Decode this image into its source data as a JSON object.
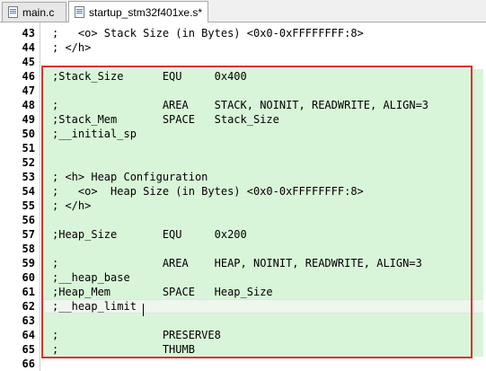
{
  "tabs": [
    {
      "label": "main.c",
      "active": false
    },
    {
      "label": "startup_stm32f401xe.s*",
      "active": true
    }
  ],
  "lines": [
    {
      "num": "43",
      "text": ";   <o> Stack Size (in Bytes) <0x0-0xFFFFFFFF:8>"
    },
    {
      "num": "44",
      "text": "; </h>"
    },
    {
      "num": "45",
      "text": ""
    },
    {
      "num": "46",
      "text": ";Stack_Size      EQU     0x400"
    },
    {
      "num": "47",
      "text": ""
    },
    {
      "num": "48",
      "text": ";                AREA    STACK, NOINIT, READWRITE, ALIGN=3"
    },
    {
      "num": "49",
      "text": ";Stack_Mem       SPACE   Stack_Size"
    },
    {
      "num": "50",
      "text": ";__initial_sp"
    },
    {
      "num": "51",
      "text": ""
    },
    {
      "num": "52",
      "text": ""
    },
    {
      "num": "53",
      "text": "; <h> Heap Configuration"
    },
    {
      "num": "54",
      "text": ";   <o>  Heap Size (in Bytes) <0x0-0xFFFFFFFF:8>"
    },
    {
      "num": "55",
      "text": "; </h>"
    },
    {
      "num": "56",
      "text": ""
    },
    {
      "num": "57",
      "text": ";Heap_Size       EQU     0x200"
    },
    {
      "num": "58",
      "text": ""
    },
    {
      "num": "59",
      "text": ";                AREA    HEAP, NOINIT, READWRITE, ALIGN=3"
    },
    {
      "num": "60",
      "text": ";__heap_base"
    },
    {
      "num": "61",
      "text": ";Heap_Mem        SPACE   Heap_Size"
    },
    {
      "num": "62",
      "text": ";__heap_limit"
    },
    {
      "num": "63",
      "text": ""
    },
    {
      "num": "64",
      "text": ";                PRESERVE8"
    },
    {
      "num": "65",
      "text": ";                THUMB"
    },
    {
      "num": "66",
      "text": ""
    }
  ],
  "colors": {
    "comment_highlight": "#d9f5d9",
    "selection_box": "#e0302d"
  }
}
